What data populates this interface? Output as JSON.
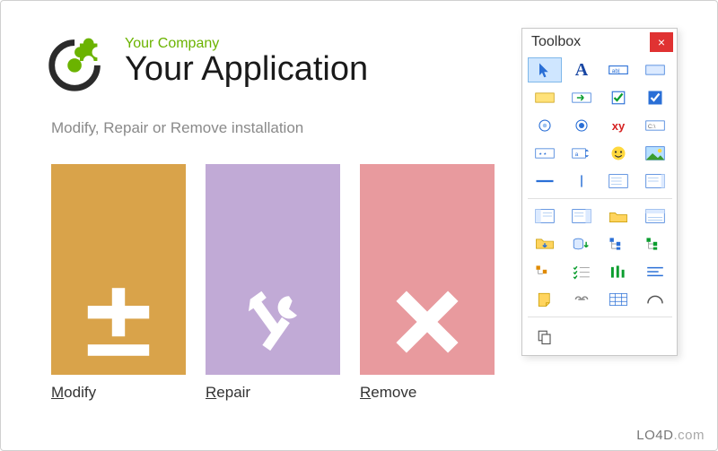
{
  "header": {
    "company": "Your Company",
    "app": "Your Application"
  },
  "instruction": "Modify, Repair or Remove installation",
  "tiles": {
    "modify": {
      "label": "Modify",
      "key": "M",
      "rest": "odify",
      "color": "#d9a34a"
    },
    "repair": {
      "label": "Repair",
      "key": "R",
      "rest": "epair",
      "color": "#c1aad6"
    },
    "remove": {
      "label": "Remove",
      "key": "R",
      "rest": "emove",
      "color": "#e89a9e"
    }
  },
  "toolbox": {
    "title": "Toolbox",
    "close": "×",
    "tools": [
      "pointer",
      "text-label",
      "textbox",
      "panel",
      "groupbox",
      "go-button",
      "checkbox",
      "checkbox-filled",
      "radio-unchecked",
      "radio-checked",
      "html-label",
      "console",
      "password",
      "spinner",
      "smiley",
      "image",
      "h-line",
      "v-line",
      "list-panel",
      "scroll-panel",
      "nav-left",
      "nav-right",
      "folder-open",
      "props-panel",
      "folder-down",
      "db-down",
      "tree-blue",
      "tree-green",
      "tree-orange",
      "checklist",
      "bars",
      "align",
      "note",
      "link",
      "grid-blue",
      "arc"
    ]
  },
  "watermark": "LO4D.com"
}
